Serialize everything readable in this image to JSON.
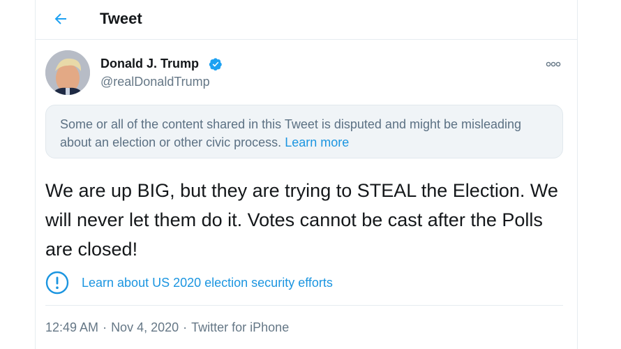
{
  "header": {
    "title": "Tweet",
    "back_icon": "back-arrow-icon"
  },
  "author": {
    "name": "Donald J. Trump",
    "handle": "@realDonaldTrump",
    "verified_icon": "verified-badge-icon",
    "more_icon": "more-options-icon"
  },
  "notice": {
    "text": "Some or all of the content shared in this Tweet is disputed and might be misleading about an election or other civic process.",
    "link_label": "Learn more"
  },
  "tweet": {
    "text": "We are up BIG, but they are trying to STEAL the Election. We will never let them do it. Votes cannot be cast after the Polls are closed!"
  },
  "election_info": {
    "icon": "info-exclamation-icon",
    "link_label": "Learn about US 2020 election security efforts"
  },
  "meta": {
    "time": "12:49 AM",
    "date": "Nov 4, 2020",
    "source": "Twitter for iPhone",
    "separator": "·"
  },
  "colors": {
    "accent": "#1b95e0",
    "text_primary": "#14171a",
    "text_secondary": "#657786",
    "notice_bg": "#f0f4f7"
  }
}
